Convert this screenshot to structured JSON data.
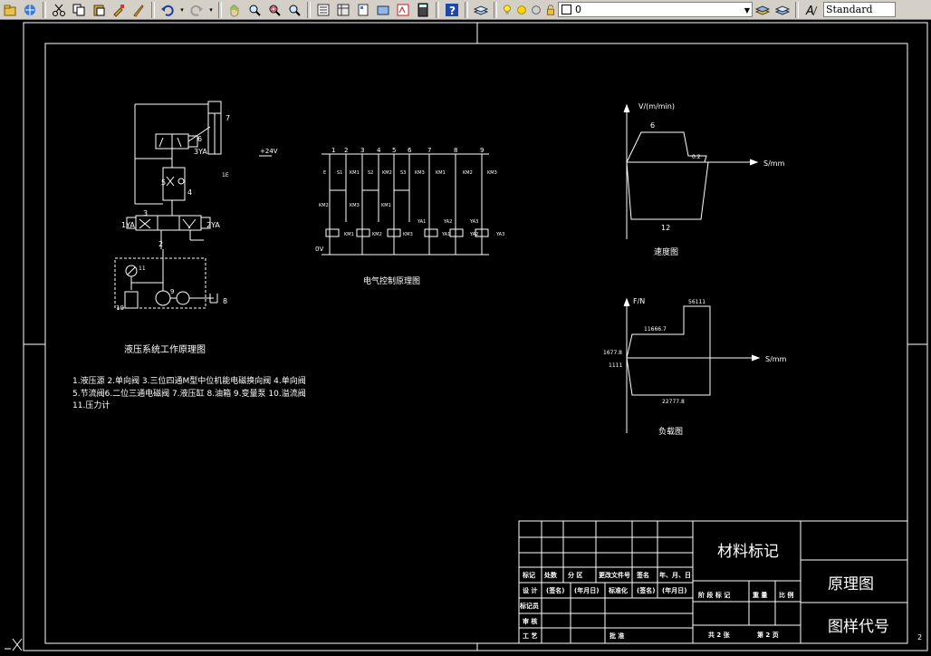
{
  "toolbar": {
    "layer_value": "0",
    "text_style": "Standard",
    "icons": [
      "open-icon",
      "publish-icon",
      "cut-icon",
      "copy-icon",
      "paste-icon",
      "match-properties-icon",
      "brush-icon",
      "undo-icon",
      "redo-icon",
      "pan-icon",
      "zoom-realtime-icon",
      "zoom-window-icon",
      "zoom-previous-icon",
      "properties-icon",
      "design-center-icon",
      "tool-palettes-icon",
      "sheet-set-icon",
      "markup-icon",
      "calculator-icon",
      "help-icon",
      "layer-manager-icon",
      "lightbulb-icon",
      "sun-icon",
      "freeze-icon",
      "lock-icon",
      "color-icon",
      "layer-previous-icon",
      "layer-states-icon",
      "text-style-icon"
    ]
  },
  "drawing": {
    "hydraulic": {
      "title": "液压系统工作原理图",
      "labels": {
        "n7": "7",
        "n6": "6",
        "n3ya": "3YA",
        "n5": "5",
        "n4": "4",
        "n1e": "1E",
        "n3": "3",
        "n1ya": "1YA",
        "n2ya": "2YA",
        "n2": "2",
        "n11": "11",
        "n9": "9",
        "n10": "10",
        "n8": "8"
      }
    },
    "legend": {
      "line1": "1.液压源 2.单向阀 3.三位四通M型中位机能电磁换向阀 4.单向阀",
      "line2": "5.节流阀6.二位三通电磁阀 7.液压缸 8.油箱 9.变量泵 10.溢流阀",
      "line3": "11.压力计"
    },
    "electrical": {
      "title": "电气控制原理图",
      "supply": "+24V",
      "ground": "0V",
      "columns": [
        "1",
        "2",
        "3",
        "4",
        "5",
        "6",
        "7",
        "8",
        "9"
      ],
      "switches": [
        "E",
        "S1",
        "KM1",
        "S2",
        "KM2",
        "S3",
        "KM3",
        "KM1",
        "KM2",
        "KM3"
      ],
      "row2": [
        "KM2",
        "KM3",
        "KM1"
      ],
      "coils": [
        "KM1",
        "KM2",
        "KM3",
        "YA1",
        "YA2",
        "YA3"
      ],
      "coil_labels": [
        "YA1",
        "YA2",
        "YA3"
      ]
    },
    "speed_chart": {
      "title": "速度图",
      "ylabel": "V/(m/min)",
      "xlabel": "S/mm",
      "labels": {
        "v_fast": "6",
        "v_slow": "0.2",
        "s_work": "12"
      }
    },
    "load_chart": {
      "title": "负载图",
      "ylabel": "F/N",
      "xlabel": "S/mm",
      "labels": {
        "f_max": "56111",
        "f_mid": "11666.7",
        "f_a": "1677.8",
        "f_b": "1111",
        "f_neg": "22777.8"
      }
    },
    "title_block": {
      "material": "材料标记",
      "name": "原理图",
      "code": "图样代号",
      "headers": [
        "标记",
        "处数",
        "分 区",
        "更改文件号",
        "签名",
        "年、月、日"
      ],
      "design_row": [
        "设 计",
        "(签名)",
        "(年月日)",
        "标准化",
        "(签名)",
        "(年月日)"
      ],
      "rows": [
        "标记员",
        "审 核",
        "工 艺"
      ],
      "approve": "批 准",
      "stage": "阶 段 标 记",
      "weight": "重 量",
      "scale": "比 例",
      "sheets": "共 2 张",
      "sheet_no": "第 2 页"
    },
    "right_marker": "2"
  }
}
